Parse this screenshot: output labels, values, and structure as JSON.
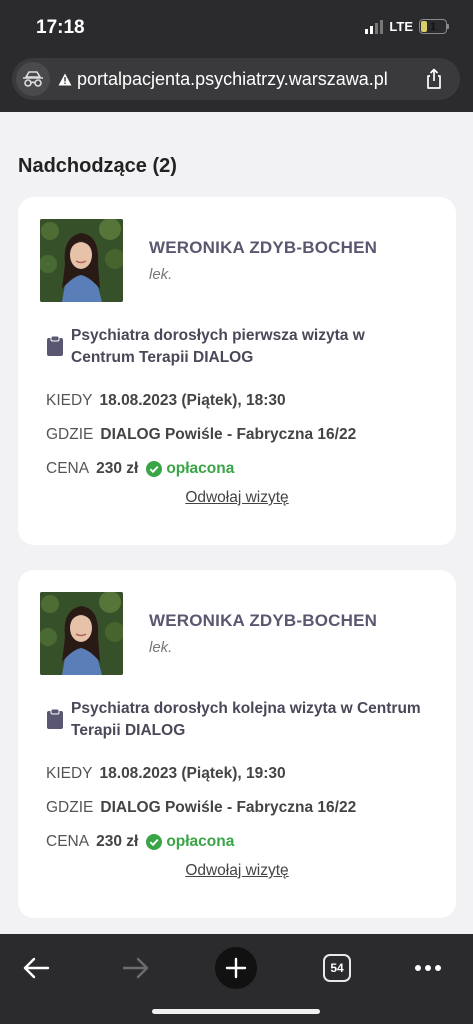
{
  "status": {
    "time": "17:18",
    "network": "LTE",
    "battery": "1"
  },
  "browser": {
    "url": "portalpacjenta.psychiatrzy.warszawa.pl",
    "tab_count": "54"
  },
  "section": {
    "title": "Nadchodzące (2)"
  },
  "labels": {
    "when": "KIEDY",
    "where": "GDZIE",
    "price": "CENA"
  },
  "appointments": [
    {
      "doctor_name": "WERONIKA ZDYB-BOCHEN",
      "doctor_title": "lek.",
      "visit_type": "Psychiatra dorosłych pierwsza wizyta w Centrum Terapii DIALOG",
      "when": "18.08.2023 (Piątek), 18:30",
      "where": "DIALOG Powiśle - Fabryczna 16/22",
      "price": "230 zł",
      "payment_status": "opłacona",
      "cancel_label": "Odwołaj wizytę"
    },
    {
      "doctor_name": "WERONIKA ZDYB-BOCHEN",
      "doctor_title": "lek.",
      "visit_type": "Psychiatra dorosłych kolejna wizyta w Centrum Terapii DIALOG",
      "when": "18.08.2023 (Piątek), 19:30",
      "where": "DIALOG Powiśle - Fabryczna 16/22",
      "price": "230 zł",
      "payment_status": "opłacona",
      "cancel_label": "Odwołaj wizytę"
    }
  ],
  "colors": {
    "chrome": "#2b2b2d",
    "page_bg": "#f2f2f4",
    "doctor_name": "#5a5870",
    "paid_green": "#3aa547"
  }
}
